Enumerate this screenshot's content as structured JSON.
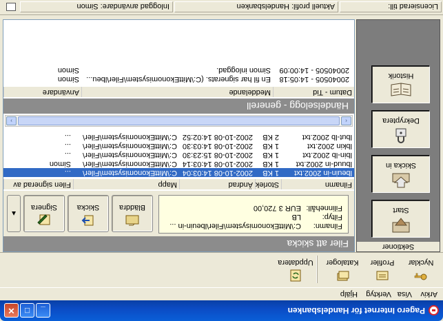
{
  "window": {
    "title": "Pagero Internet för Handelsbanken",
    "buttons": {
      "minimize": "_",
      "maximize": "□",
      "close": "✕"
    }
  },
  "menu": [
    "Arkiv",
    "Visa",
    "Verktyg",
    "Hjälp"
  ],
  "toolbar": {
    "items": [
      {
        "label": "Nycklar",
        "icon": "key-icon"
      },
      {
        "label": "Profiler",
        "icon": "profile-card-icon"
      },
      {
        "label": "Kataloger",
        "icon": "folders-icon"
      },
      {
        "label": "Uppdatera",
        "icon": "refresh-icon"
      }
    ]
  },
  "sections": {
    "header": "Sektioner",
    "items": [
      {
        "label": "Start",
        "icon": "start-icon"
      },
      {
        "label": "Skicka in",
        "icon": "send-in-icon"
      },
      {
        "label": "Dekryptera",
        "icon": "decrypt-lock-icon"
      },
      {
        "label": "Historik",
        "icon": "history-book-icon"
      }
    ]
  },
  "files_to_send": {
    "header": "Filer att skicka",
    "info": {
      "filename_label": "Filnamn:",
      "filename_value": "C:\\MittEkonomisystem\\Filer\\lbeuin-in ...",
      "filetype_label": "Filtyp:",
      "filetype_value": "LB",
      "amount_label": "Filinnehåll:",
      "amount_value": "EUR 3 720,00"
    },
    "actions": {
      "browse": "Bläddra",
      "send": "Skicka",
      "sign": "Signera"
    },
    "scroll_arrow": "▲"
  },
  "file_list": {
    "columns": [
      "Filnamn",
      "Storlek",
      "Ändrad",
      "Mapp",
      "Filen signerad av"
    ],
    "rows": [
      {
        "name": "lbeuin-in 2002.txt",
        "size": "1 KB",
        "modified": "2002-10-08 14:03:04",
        "folder": "C:\\MittEkonomisystem\\Filer\\",
        "signed_by": "...",
        "selected": true
      },
      {
        "name": "lbuud-in 2002.txt",
        "size": "1 KB",
        "modified": "2002-10-08 14:03:14",
        "folder": "C:\\MittEkonomisystem\\Filer\\",
        "signed_by": "Simon",
        "selected": false
      },
      {
        "name": "lbin-lb 2002.txt",
        "size": "1 KB",
        "modified": "2002-10-08 15:23:30",
        "folder": "C:\\MittEkonomisystem\\Filer\\",
        "signed_by": "...",
        "selected": false
      },
      {
        "name": "lbkin 2002.txt",
        "size": "1 KB",
        "modified": "2002-10-08 14:03:30",
        "folder": "C:\\MittEkonomisystem\\Filer\\",
        "signed_by": "...",
        "selected": false
      },
      {
        "name": "lbut-lb 2002.txt",
        "size": "2 KB",
        "modified": "2002-10-08 14:02:52",
        "folder": "C:\\MittEkonomisystem\\Filer\\",
        "signed_by": "...",
        "selected": false
      }
    ],
    "scroll_left": "‹",
    "scroll_right": "›"
  },
  "event_log": {
    "header": "Händelselogg - generell",
    "columns": [
      "Datum - Tid",
      "Meddelande",
      "Användare"
    ],
    "rows": [
      {
        "datetime": "20040505 - 14:05:18",
        "message": "En fil har signerats. (C:\\MittEkonomisystem\\Filer\\lbeu...",
        "user": "Simon"
      },
      {
        "datetime": "20040505 - 14:00:09",
        "message": "Simon inloggad.",
        "user": "Simon"
      }
    ]
  },
  "status": {
    "licensed": "Licensierad till:",
    "profile": "Aktuell profil: Handelsbanken",
    "user": "Inloggad användare: Simon"
  }
}
